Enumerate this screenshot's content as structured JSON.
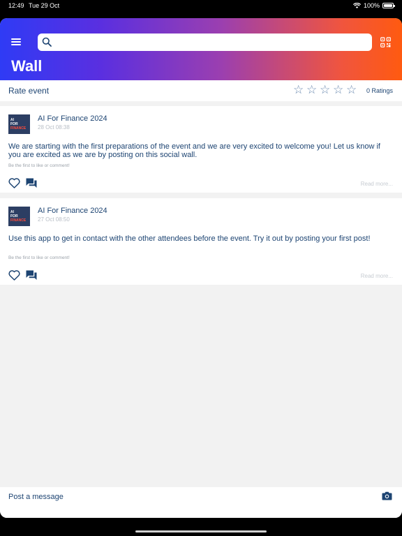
{
  "status": {
    "time": "12:49",
    "date": "Tue 29 Oct",
    "battery": "100%"
  },
  "header": {
    "title": "Wall",
    "search_placeholder": ""
  },
  "rating": {
    "label": "Rate event",
    "ratings_text": "0 Ratings",
    "stars": 5
  },
  "posts": [
    {
      "avatar_lines": [
        "AI",
        "FOR",
        "FINANCE"
      ],
      "author": "AI For Finance 2024",
      "date": "28 Oct 08:38",
      "text": "We are starting with the first preparations of the event and we are very excited to welcome you! Let us know if you are excited as we are by posting on this social wall.",
      "hint": "Be the first to like or comment!",
      "read_more": "Read more..."
    },
    {
      "avatar_lines": [
        "AI",
        "FOR",
        "FINANCE"
      ],
      "author": "AI For Finance 2024",
      "date": "27 Oct 08:50",
      "text": "Use this app to get in contact with the other attendees before the event. Try it out by posting your first post!",
      "hint": "Be the first to like or comment!",
      "read_more": "Read more..."
    }
  ],
  "composer": {
    "placeholder": "Post a message"
  },
  "colors": {
    "primary": "#1d4472",
    "gradient_start": "#2f3bf5",
    "gradient_end": "#ff5a10"
  },
  "icons": [
    "menu-icon",
    "search-icon",
    "qr-code-icon",
    "star-icon",
    "heart-icon",
    "comment-icon",
    "camera-icon",
    "wifi-icon",
    "battery-icon"
  ]
}
